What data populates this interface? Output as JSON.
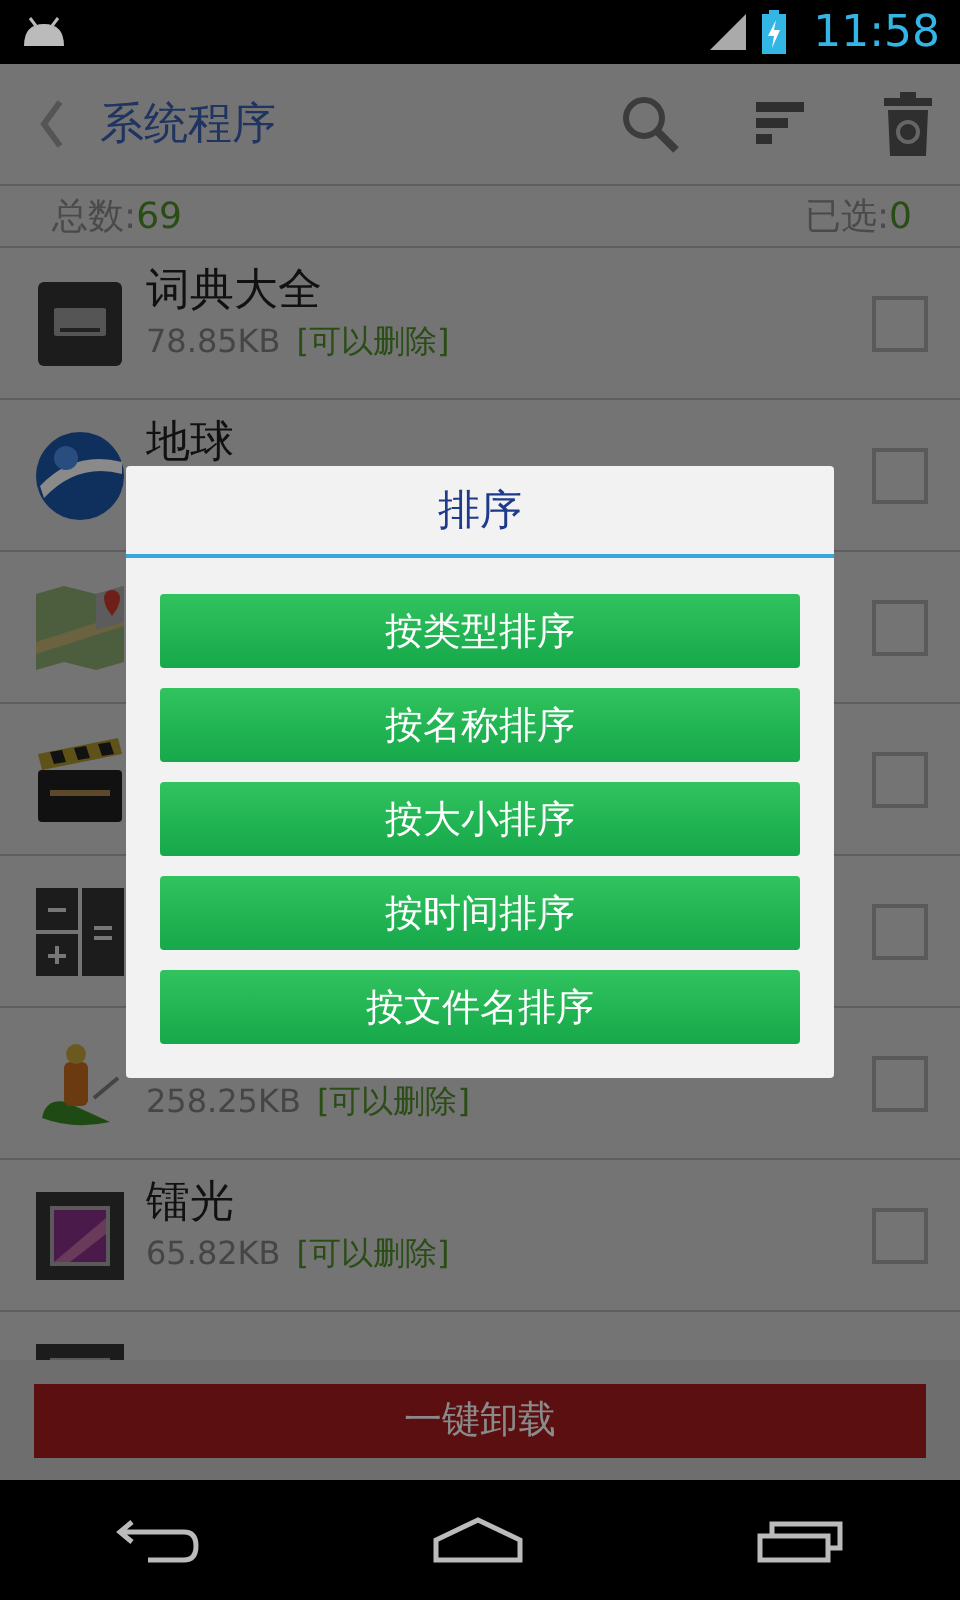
{
  "status_bar": {
    "time": "11:58"
  },
  "toolbar": {
    "title": "系统程序"
  },
  "summary": {
    "total_label": "总数:",
    "total": "69",
    "selected_label": "已选:",
    "selected": "0"
  },
  "apps": [
    {
      "name": "词典大全",
      "size": "78.85KB",
      "tag": "[可以删除]",
      "checked": false
    },
    {
      "name": "地球",
      "checked": false
    },
    {
      "checked": false
    },
    {
      "checked": false
    },
    {
      "checked": false
    },
    {
      "size": "258.25KB",
      "tag": "[可以删除]",
      "checked": false
    },
    {
      "name": "镭光",
      "size": "65.82KB",
      "tag": "[可以删除]",
      "checked": false
    }
  ],
  "uninstall_button": "一键卸载",
  "sort_dialog": {
    "title": "排序",
    "options": [
      "按类型排序",
      "按名称排序",
      "按大小排序",
      "按时间排序",
      "按文件名排序"
    ]
  }
}
